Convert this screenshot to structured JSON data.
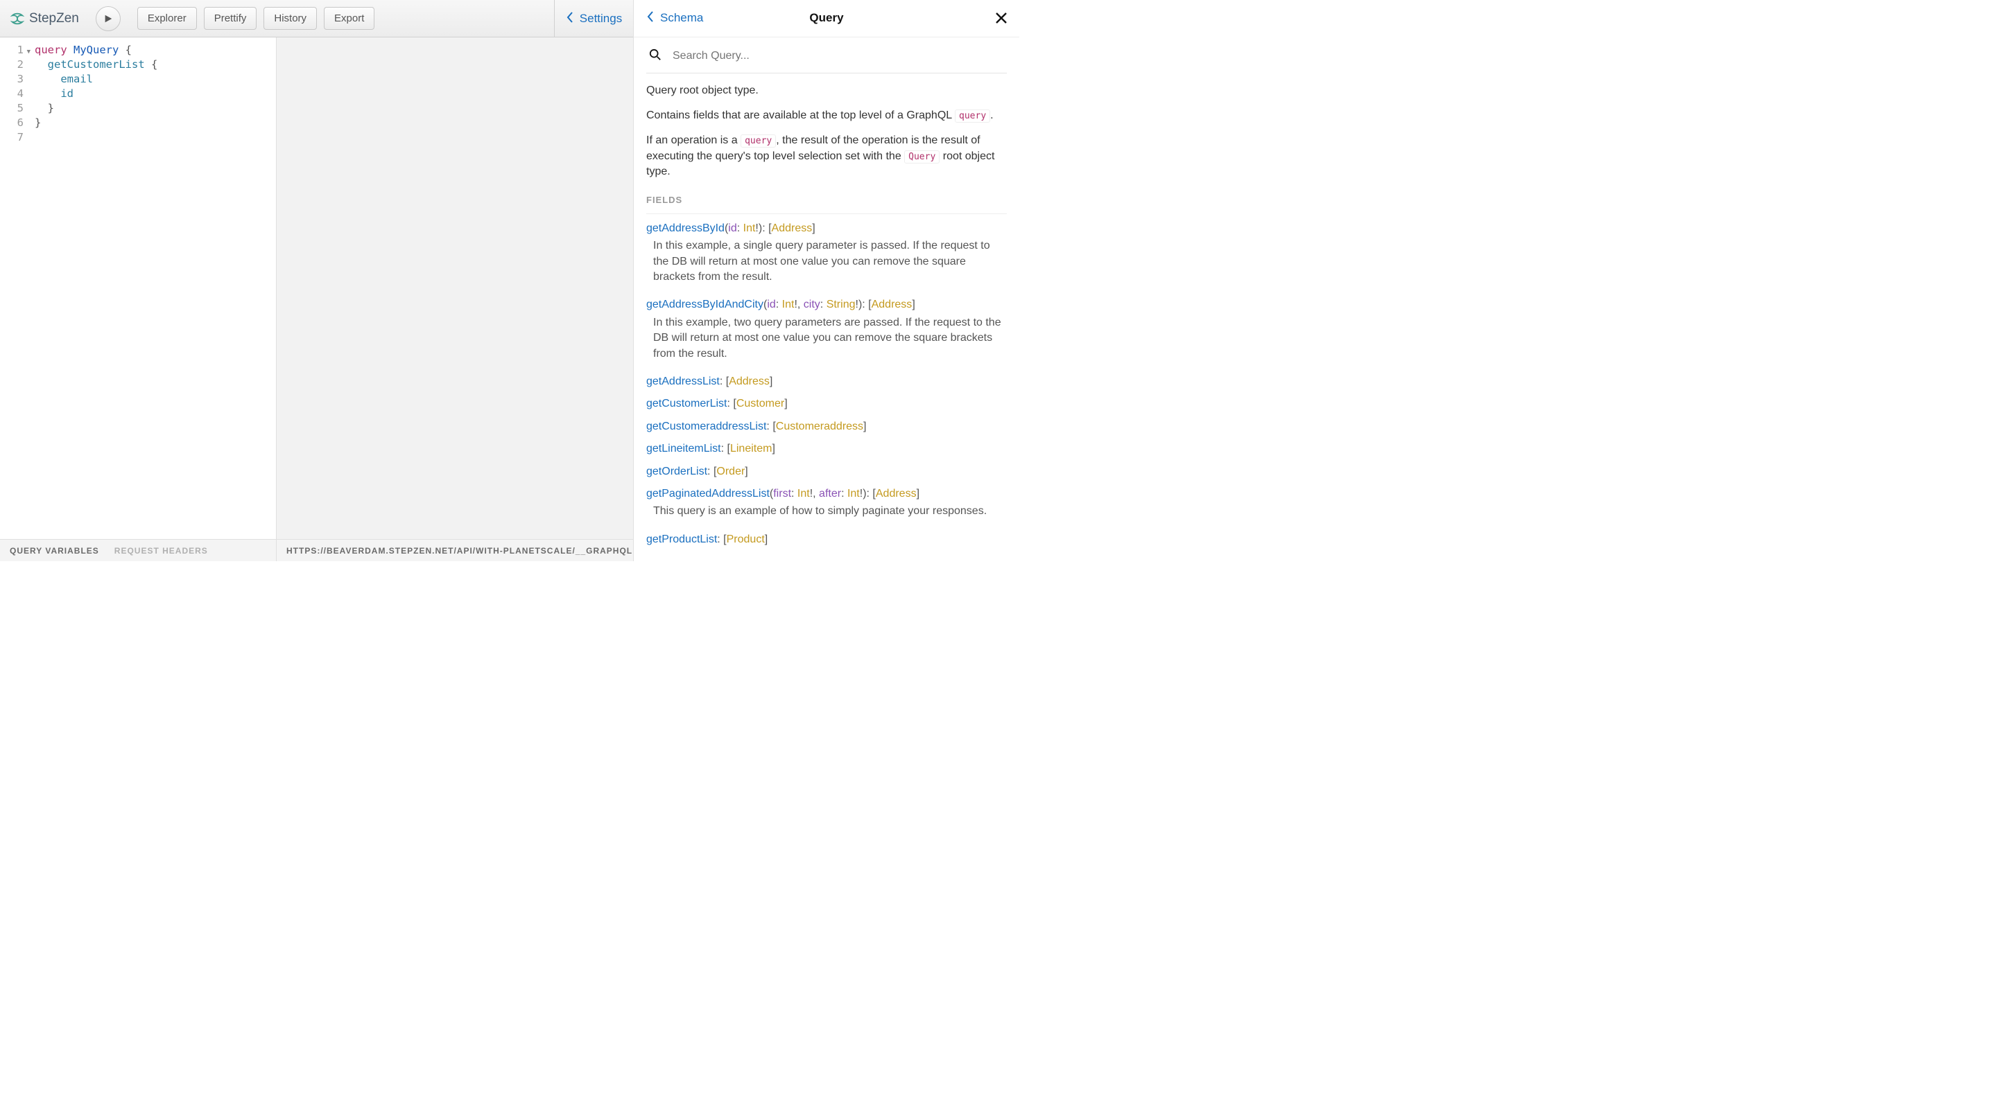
{
  "brand": "StepZen",
  "toolbar": {
    "explorer": "Explorer",
    "prettify": "Prettify",
    "history": "History",
    "export": "Export"
  },
  "settings_label": "Settings",
  "editor": {
    "line_numbers": [
      "1",
      "2",
      "3",
      "4",
      "5",
      "6",
      "7"
    ],
    "tokens": [
      [
        {
          "t": "query ",
          "c": "tok-keyword"
        },
        {
          "t": "MyQuery",
          "c": "tok-def"
        },
        {
          "t": " {",
          "c": "tok-punct"
        }
      ],
      [
        {
          "t": "  ",
          "c": ""
        },
        {
          "t": "getCustomerList",
          "c": "tok-field"
        },
        {
          "t": " {",
          "c": "tok-punct"
        }
      ],
      [
        {
          "t": "    ",
          "c": ""
        },
        {
          "t": "email",
          "c": "tok-field"
        }
      ],
      [
        {
          "t": "    ",
          "c": ""
        },
        {
          "t": "id",
          "c": "tok-field"
        }
      ],
      [
        {
          "t": "  }",
          "c": "tok-punct"
        }
      ],
      [
        {
          "t": "}",
          "c": "tok-punct"
        }
      ],
      []
    ]
  },
  "footer_tabs": {
    "query_variables": "QUERY VARIABLES",
    "request_headers": "REQUEST HEADERS",
    "endpoint": "HTTPS://BEAVERDAM.STEPZEN.NET/API/WITH-PLANETSCALE/__GRAPHQL"
  },
  "docs": {
    "back_label": "Schema",
    "title": "Query",
    "search_placeholder": "Search Query...",
    "desc_para1": "Query root object type.",
    "desc_para2a": "Contains fields that are available at the top level of a GraphQL ",
    "desc_para2_code": "query",
    "desc_para2b": ".",
    "desc_para3a": "If an operation is a ",
    "desc_para3_code1": "query",
    "desc_para3b": ", the result of the operation is the result of executing the query's top level selection set with the ",
    "desc_para3_code2": "Query",
    "desc_para3c": " root object type.",
    "fields_label": "FIELDS",
    "fields": [
      {
        "name": "getAddressById",
        "args": [
          {
            "name": "id",
            "type": "Int",
            "nonnull": true
          }
        ],
        "return_list": true,
        "return_type": "Address",
        "desc": "In this example, a single query parameter is passed. If the request to the DB will return at most one value you can remove the square brackets from the result."
      },
      {
        "name": "getAddressByIdAndCity",
        "args": [
          {
            "name": "id",
            "type": "Int",
            "nonnull": true
          },
          {
            "name": "city",
            "type": "String",
            "nonnull": true
          }
        ],
        "return_list": true,
        "return_type": "Address",
        "desc": "In this example, two query parameters are passed. If the request to the DB will return at most one value you can remove the square brackets from the result."
      },
      {
        "name": "getAddressList",
        "args": [],
        "return_list": true,
        "return_type": "Address",
        "desc": ""
      },
      {
        "name": "getCustomerList",
        "args": [],
        "return_list": true,
        "return_type": "Customer",
        "desc": ""
      },
      {
        "name": "getCustomeraddressList",
        "args": [],
        "return_list": true,
        "return_type": "Customeraddress",
        "desc": ""
      },
      {
        "name": "getLineitemList",
        "args": [],
        "return_list": true,
        "return_type": "Lineitem",
        "desc": ""
      },
      {
        "name": "getOrderList",
        "args": [],
        "return_list": true,
        "return_type": "Order",
        "desc": ""
      },
      {
        "name": "getPaginatedAddressList",
        "args": [
          {
            "name": "first",
            "type": "Int",
            "nonnull": true
          },
          {
            "name": "after",
            "type": "Int",
            "nonnull": true
          }
        ],
        "return_list": true,
        "return_type": "Address",
        "desc": "This query is an example of how to simply paginate your responses."
      },
      {
        "name": "getProductList",
        "args": [],
        "return_list": true,
        "return_type": "Product",
        "desc": ""
      }
    ]
  }
}
